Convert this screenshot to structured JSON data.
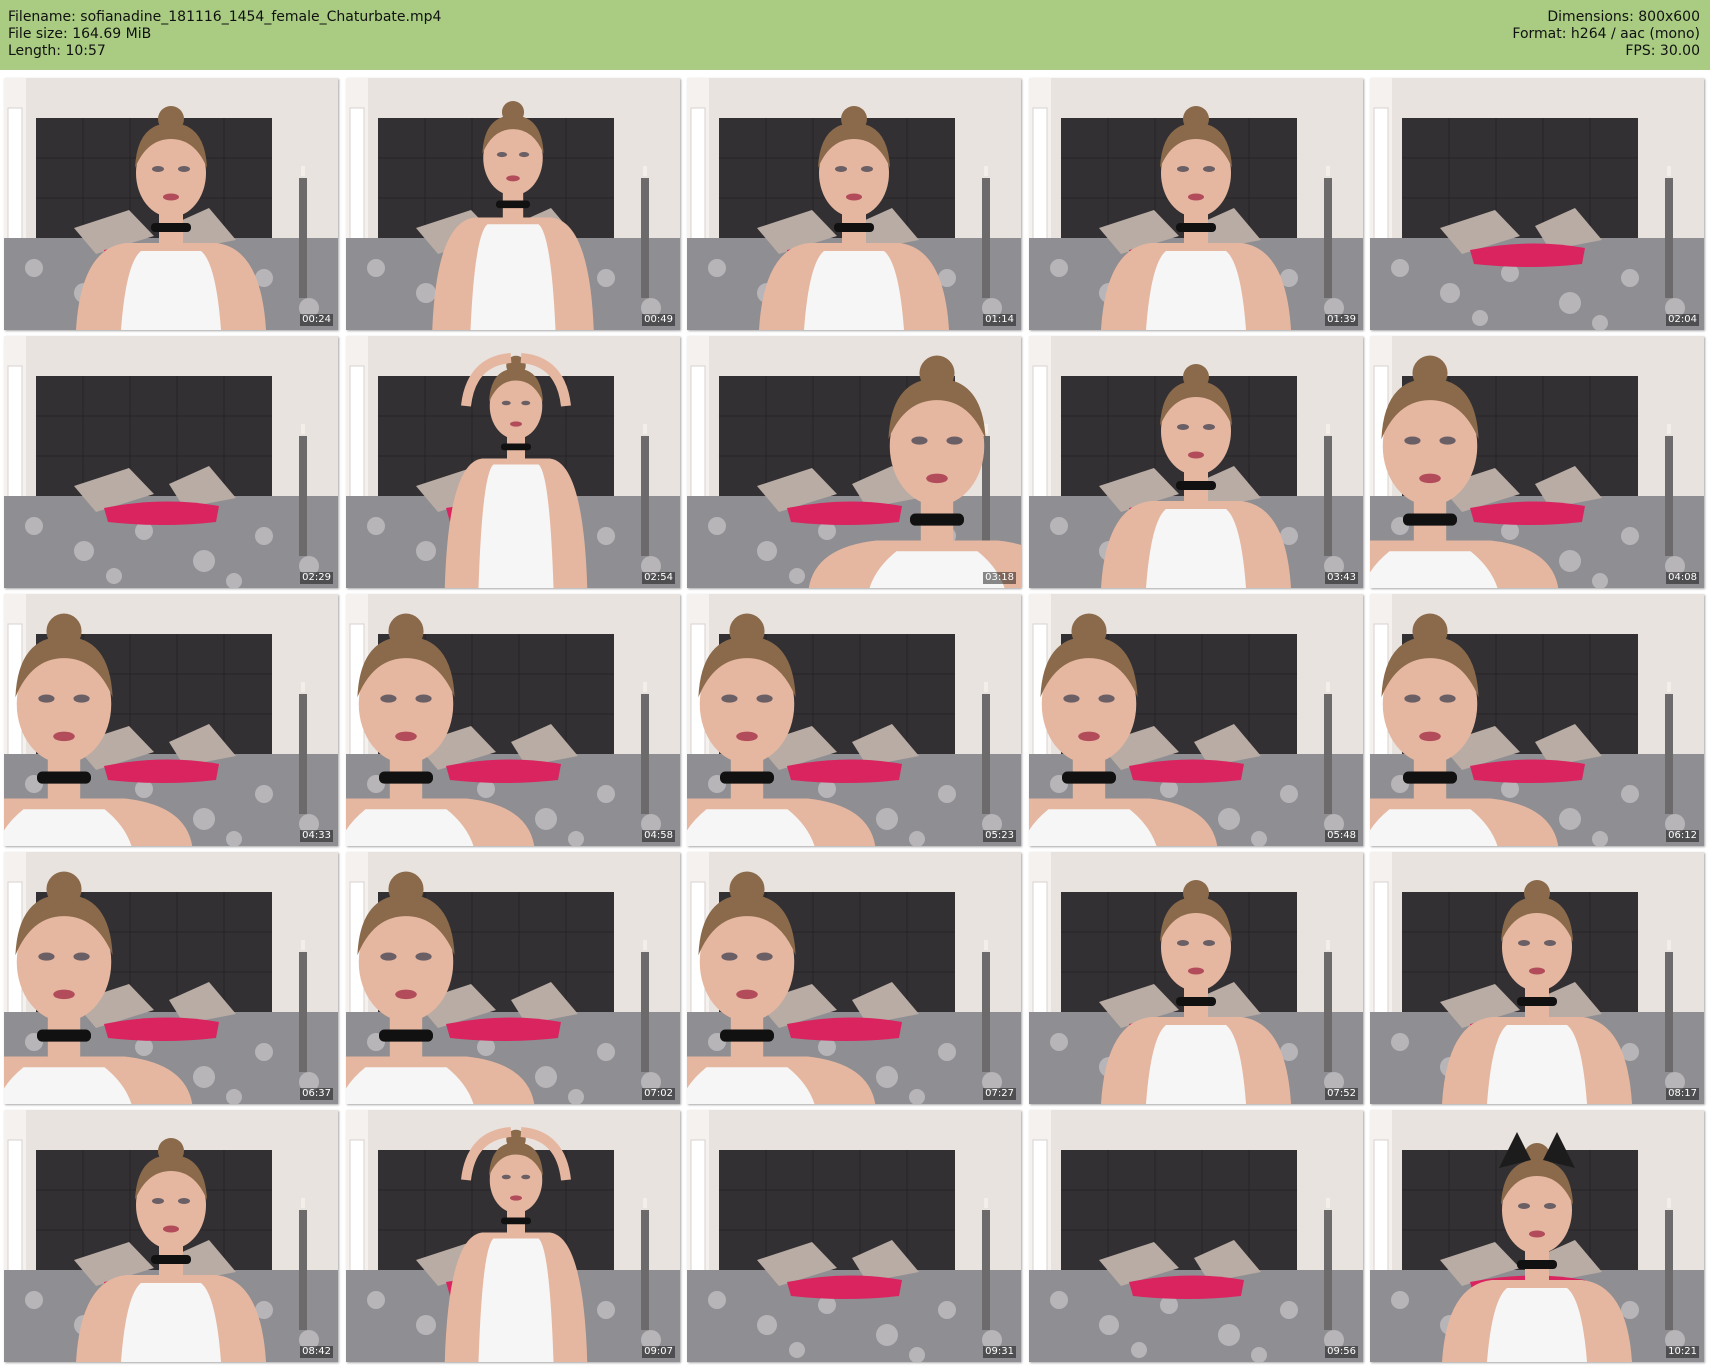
{
  "header": {
    "left": [
      "Filename: sofianadine_181116_1454_female_Chaturbate.mp4",
      "File size: 164.69 MiB",
      "Length: 10:57"
    ],
    "right": [
      "Dimensions: 800x600",
      "Format: h264 / aac (mono)",
      "FPS: 30.00"
    ],
    "background": "#a9cc82"
  },
  "thumbnails": [
    {
      "time": "00:24",
      "scene": "woman-close"
    },
    {
      "time": "00:49",
      "scene": "woman-seated"
    },
    {
      "time": "01:14",
      "scene": "woman-close"
    },
    {
      "time": "01:39",
      "scene": "woman-close"
    },
    {
      "time": "02:04",
      "scene": "empty-bed"
    },
    {
      "time": "02:29",
      "scene": "empty-bed"
    },
    {
      "time": "02:54",
      "scene": "woman-arms-up"
    },
    {
      "time": "03:18",
      "scene": "woman-face-right"
    },
    {
      "time": "03:43",
      "scene": "woman-close"
    },
    {
      "time": "04:08",
      "scene": "woman-face-left"
    },
    {
      "time": "04:33",
      "scene": "woman-face-left"
    },
    {
      "time": "04:58",
      "scene": "woman-face-left"
    },
    {
      "time": "05:23",
      "scene": "woman-face-left"
    },
    {
      "time": "05:48",
      "scene": "woman-face-left"
    },
    {
      "time": "06:12",
      "scene": "woman-face-left"
    },
    {
      "time": "06:37",
      "scene": "woman-face-left"
    },
    {
      "time": "07:02",
      "scene": "woman-face-left"
    },
    {
      "time": "07:27",
      "scene": "woman-face-left"
    },
    {
      "time": "07:52",
      "scene": "woman-close"
    },
    {
      "time": "08:17",
      "scene": "woman-close"
    },
    {
      "time": "08:42",
      "scene": "woman-close"
    },
    {
      "time": "09:07",
      "scene": "woman-arms-up"
    },
    {
      "time": "09:31",
      "scene": "empty-bed"
    },
    {
      "time": "09:56",
      "scene": "empty-bed"
    },
    {
      "time": "10:21",
      "scene": "woman-cat-ears"
    }
  ],
  "colors": {
    "wall": "#e9e3e0",
    "headboard": "#333033",
    "bedspread": "#8f8e92",
    "pillow": "#b8aca4",
    "blanket": "#d9245f",
    "skin": "#e6b7a0",
    "hair": "#8a6a4a",
    "top": "#f6f6f6",
    "choker": "#111111"
  }
}
